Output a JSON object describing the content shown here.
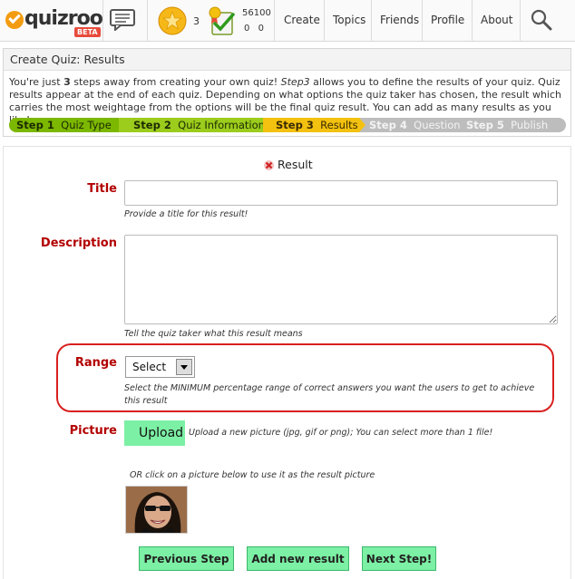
{
  "brand": {
    "logo_text": "quizroo",
    "badge": "BETA"
  },
  "header": {
    "star_count": "3",
    "points_total": "56100",
    "points_a": "0",
    "points_b": "0"
  },
  "nav": {
    "create": "Create",
    "topics": "Topics",
    "friends": "Friends",
    "profile": "Profile",
    "about": "About"
  },
  "panel": {
    "title": "Create Quiz: Results",
    "intro_pre": "You're just ",
    "intro_num": "3",
    "intro_mid": " steps away from creating your own quiz! ",
    "intro_step": "Step3",
    "intro_post": " allows you to define the results of your quiz. Quiz results appear at the end of each quiz. Depending on what options the quiz taker has chosen, the result which carries the most weightage from the options will be the final quiz result. You can add as many results as you like!"
  },
  "steps": [
    {
      "num": "Step 1",
      "label": "Quiz Type",
      "state": "done"
    },
    {
      "num": "Step 2",
      "label": "Quiz Information",
      "state": "done"
    },
    {
      "num": "Step 3",
      "label": "Results",
      "state": "current"
    },
    {
      "num": "Step 4",
      "label": "Question",
      "state": "todo"
    },
    {
      "num": "Step 5",
      "label": "Publish",
      "state": "todo"
    }
  ],
  "form": {
    "result_heading": "Result",
    "title_label": "Title",
    "title_value": "",
    "title_hint": "Provide a title for this result!",
    "description_label": "Description",
    "description_value": "",
    "description_hint": "Tell the quiz taker what this result means",
    "range_label": "Range",
    "range_selected": "Select",
    "range_hint": "Select the MINIMUM percentage range of correct answers you want the users to get to achieve this result",
    "picture_label": "Picture",
    "upload_label": "Upload",
    "upload_hint": "Upload a new picture (jpg, gif or png); You can select more than 1 file!",
    "or_hint": "OR click on a picture below to use it as the result picture"
  },
  "actions": {
    "previous": "Previous Step",
    "add": "Add new result",
    "next": "Next Step!"
  },
  "colors": {
    "step_done": "#7cb800",
    "step_current": "#f3c10f",
    "label_red": "#b30000",
    "button_green": "#7cf0a4",
    "range_ring": "#d92020"
  }
}
